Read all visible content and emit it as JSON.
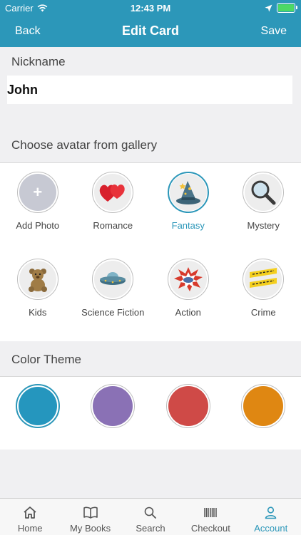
{
  "status_bar": {
    "carrier": "Carrier",
    "time": "12:43 PM"
  },
  "nav": {
    "back": "Back",
    "title": "Edit Card",
    "save": "Save"
  },
  "nickname": {
    "label": "Nickname",
    "value": "John"
  },
  "gallery": {
    "label": "Choose avatar from gallery",
    "items": [
      {
        "label": "Add Photo",
        "icon": "plus-icon"
      },
      {
        "label": "Romance",
        "icon": "hearts-icon"
      },
      {
        "label": "Fantasy",
        "icon": "wizard-hat-icon",
        "selected": true
      },
      {
        "label": "Mystery",
        "icon": "magnifier-icon"
      },
      {
        "label": "Kids",
        "icon": "teddy-bear-icon"
      },
      {
        "label": "Science Fiction",
        "icon": "ufo-icon"
      },
      {
        "label": "Action",
        "icon": "boom-icon"
      },
      {
        "label": "Crime",
        "icon": "crime-tape-icon"
      }
    ]
  },
  "color_theme": {
    "label": "Color Theme",
    "swatches": [
      {
        "color": "#2596be",
        "selected": true
      },
      {
        "color": "#8a71b5"
      },
      {
        "color": "#cf4a47"
      },
      {
        "color": "#df8712"
      }
    ]
  },
  "tabbar": {
    "items": [
      {
        "label": "Home",
        "icon": "home-icon"
      },
      {
        "label": "My Books",
        "icon": "book-icon"
      },
      {
        "label": "Search",
        "icon": "search-icon"
      },
      {
        "label": "Checkout",
        "icon": "barcode-icon"
      },
      {
        "label": "Account",
        "icon": "person-icon",
        "active": true
      }
    ]
  },
  "colors": {
    "accent": "#2c97b9",
    "background": "#f0f0f2"
  }
}
